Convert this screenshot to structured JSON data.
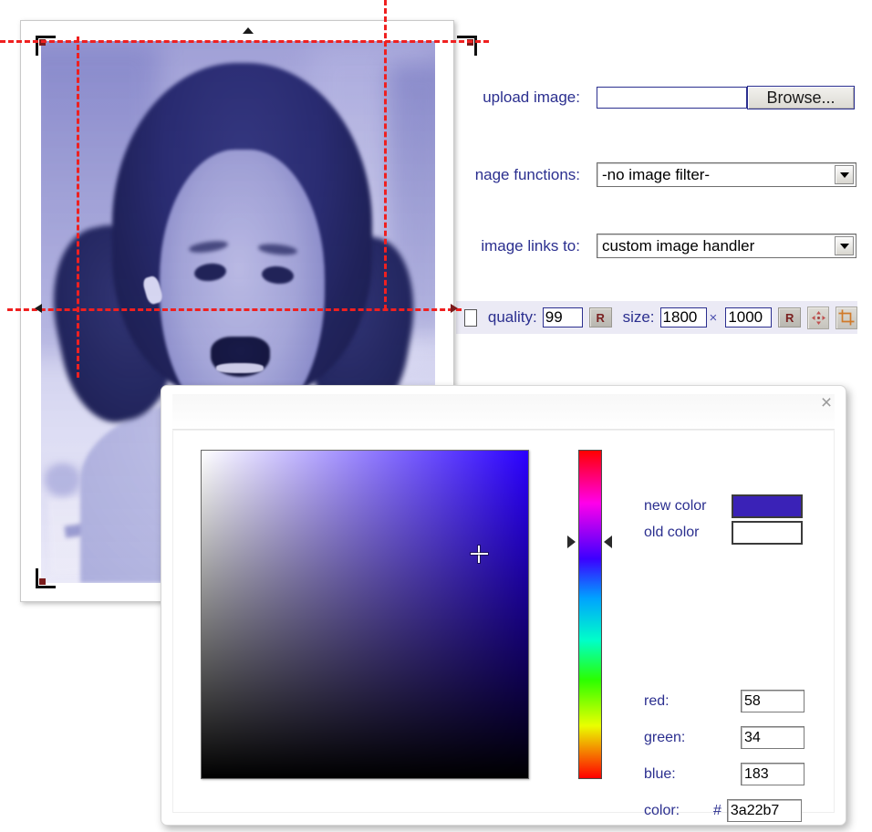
{
  "form": {
    "upload": {
      "label": "upload image:",
      "value": "",
      "placeholder": "",
      "browse_label": "Browse..."
    },
    "image_functions": {
      "label": "image functions:",
      "label_clipped": "nage functions:",
      "selected": "-no image filter-",
      "options": [
        "-no image filter-"
      ]
    },
    "image_links_to": {
      "label": "image links to:",
      "selected": "custom image handler",
      "options": [
        "custom image handler"
      ]
    }
  },
  "toolbar": {
    "quality_label": "quality:",
    "quality_value": "99",
    "quality_reset": "R",
    "size_label": "size:",
    "size_width": "1800",
    "size_separator": "×",
    "size_height": "1000",
    "size_reset": "R",
    "move_icon": "move-icon",
    "crop_icon": "crop-icon",
    "checkbox_checked": false
  },
  "photo": {
    "alt": "smiling young girl with pigtails, blue duotone",
    "crop_overlay": true
  },
  "dialog": {
    "close_label": "×",
    "new_color_label": "new color",
    "old_color_label": "old color",
    "new_color_value": "#3a22b7",
    "old_color_value": "#ffffff",
    "fields": [
      {
        "label": "red:",
        "value": "58"
      },
      {
        "label": "green:",
        "value": "34"
      },
      {
        "label": "blue:",
        "value": "183"
      }
    ],
    "color_field": {
      "label": "color:",
      "hash": "#",
      "value": "3a22b7"
    }
  },
  "colors": {
    "label_blue": "#2b2f8f",
    "picked": "#3a22b7",
    "crop_guide_red": "#ef2020",
    "toolbar_bg": "#ebeaf5",
    "reset_letter": "#7a2020"
  }
}
